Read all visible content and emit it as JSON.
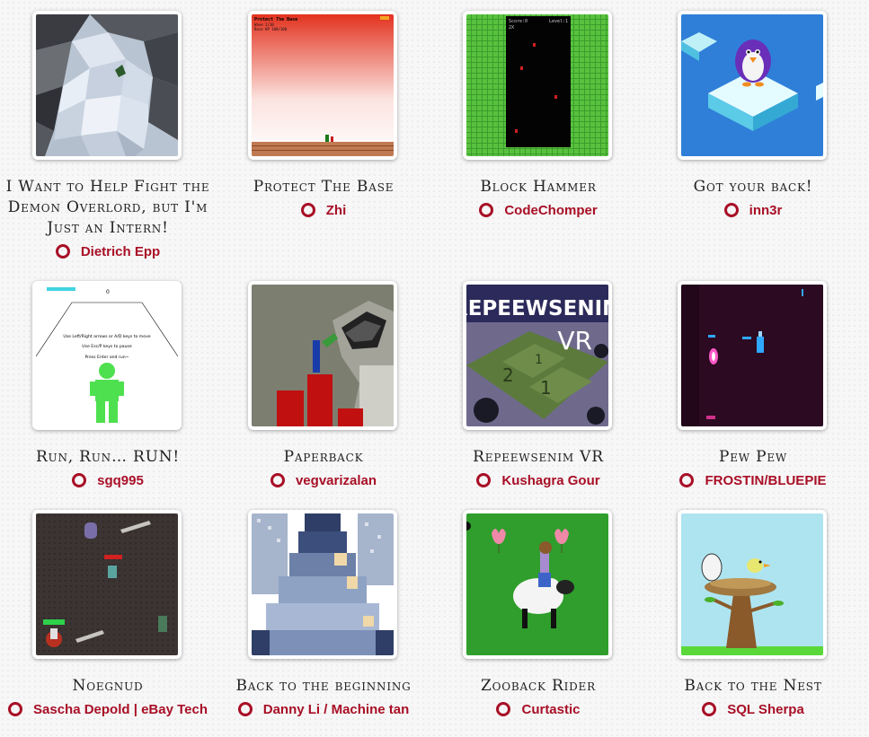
{
  "games": [
    {
      "title": "I Want to Help Fight the Demon Overlord, but I'm Just an Intern!",
      "author": "Dietrich Epp",
      "thumb": "low-poly-rocks-icon"
    },
    {
      "title": "Protect The Base",
      "author": "Zhi",
      "thumb": "red-sky-platformer-icon",
      "thumb_text": {
        "heading": "Protect The Base",
        "line1": "Wave 1/10",
        "line2": "Base HP 100/100"
      }
    },
    {
      "title": "Block Hammer",
      "author": "CodeChomper",
      "thumb": "green-tile-well-icon",
      "thumb_text": {
        "left": "Score:0",
        "right": "Level:1",
        "combo": "2X"
      }
    },
    {
      "title": "Got your back!",
      "author": "inn3r",
      "thumb": "penguin-on-ice-icon"
    },
    {
      "title": "Run, Run… RUN!",
      "author": "sgq995",
      "thumb": "runner-corridor-icon",
      "thumb_text": {
        "counter": "0",
        "line1": "Use Left/Right arrows or A/D keys to move",
        "line2": "Use Esc/P keys to pause",
        "line3": "Press Enter and run~"
      }
    },
    {
      "title": "Paperback",
      "author": "vegvarizalan",
      "thumb": "paper-platformer-icon"
    },
    {
      "title": "Repeewsenim VR",
      "author": "Kushagra Gour",
      "thumb": "minesweeper-vr-icon",
      "thumb_text": {
        "logo": "REPEEWSENIM",
        "vr": "VR",
        "n1": "1",
        "n2": "2",
        "n3": "1"
      }
    },
    {
      "title": "Pew Pew",
      "author": "FROSTIN/BLUEPIE",
      "thumb": "dark-arena-shooter-icon"
    },
    {
      "title": "Noegnud",
      "author": "Sascha Depold | eBay Tech",
      "thumb": "dungeon-topdown-icon"
    },
    {
      "title": "Back to the beginning",
      "author": "Danny Li / Machine tan",
      "thumb": "pixel-mountain-icon"
    },
    {
      "title": "Zooback Rider",
      "author": "Curtastic",
      "thumb": "sheep-rider-icon"
    },
    {
      "title": "Back to the Nest",
      "author": "SQL Sherpa",
      "thumb": "bird-nest-tree-icon"
    }
  ]
}
